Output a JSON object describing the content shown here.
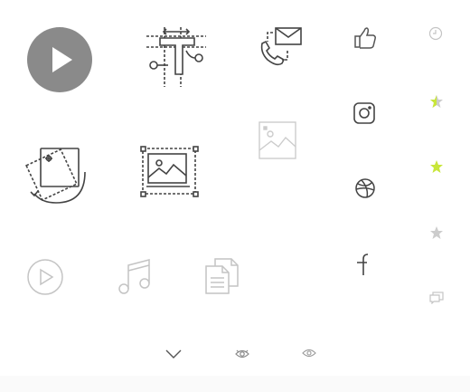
{
  "icons": [
    {
      "name": "play-circle-filled-icon"
    },
    {
      "name": "text-tool-icon"
    },
    {
      "name": "contact-mail-phone-icon"
    },
    {
      "name": "thumbs-up-icon"
    },
    {
      "name": "clock-icon"
    },
    {
      "name": "instagram-icon"
    },
    {
      "name": "star-half-icon"
    },
    {
      "name": "image-rotate-icon"
    },
    {
      "name": "image-crop-select-icon"
    },
    {
      "name": "image-placeholder-icon"
    },
    {
      "name": "dribbble-icon"
    },
    {
      "name": "star-filled-icon"
    },
    {
      "name": "star-empty-icon"
    },
    {
      "name": "play-circle-outline-icon"
    },
    {
      "name": "music-note-icon"
    },
    {
      "name": "copy-document-icon"
    },
    {
      "name": "facebook-icon"
    },
    {
      "name": "comments-icon"
    },
    {
      "name": "chevron-down-icon"
    },
    {
      "name": "eye-icon"
    },
    {
      "name": "eye-outline-icon"
    }
  ],
  "colors": {
    "play_fill": "#8a8a8a",
    "stroke_dark": "#444444",
    "stroke_mid": "#555555",
    "stroke_light": "#c4c4c4",
    "stroke_faint": "#cccccc",
    "star_yellow": "#c8e63a",
    "star_gray": "#cccccc",
    "strip": "#fafafa"
  }
}
